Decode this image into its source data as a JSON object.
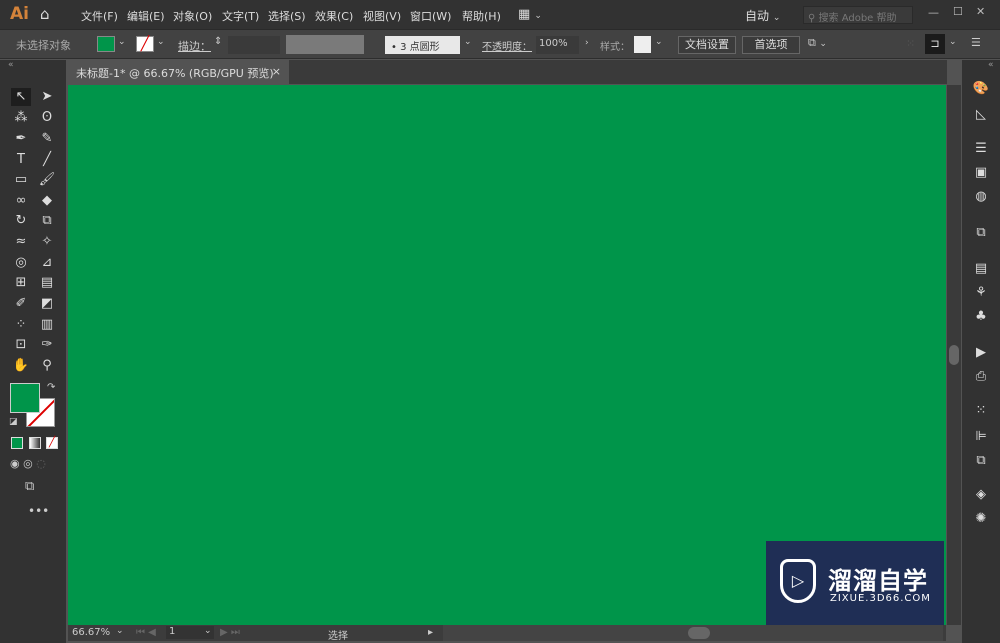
{
  "app": {
    "logo": "Ai",
    "home_icon": "home-icon"
  },
  "menu": [
    "文件(F)",
    "编辑(E)",
    "对象(O)",
    "文字(T)",
    "选择(S)",
    "效果(C)",
    "视图(V)",
    "窗口(W)",
    "帮助(H)"
  ],
  "workspace": "自动",
  "search": {
    "placeholder": "搜索 Adobe 帮助"
  },
  "window": {
    "minimize": "—",
    "maximize": "☐",
    "close": "✕"
  },
  "control": {
    "selection": "未选择对象",
    "stroke_label": "描边：",
    "brush": "3 点圆形",
    "opacity_label": "不透明度：",
    "opacity": "100%",
    "style_label": "样式：",
    "doc_setup": "文档设置",
    "preferences": "首选项",
    "fill_color": "#00954a"
  },
  "document": {
    "tab": "未标题-1* @ 66.67% (RGB/GPU 预览)",
    "close": "×"
  },
  "status": {
    "zoom": "66.67%",
    "artboard": "1",
    "tool": "选择"
  },
  "watermark": {
    "title": "溜溜自学",
    "url": "ZIXUE.3D66.COM"
  },
  "colors": {
    "canvas": "#00954a",
    "fill": "#00954a"
  }
}
